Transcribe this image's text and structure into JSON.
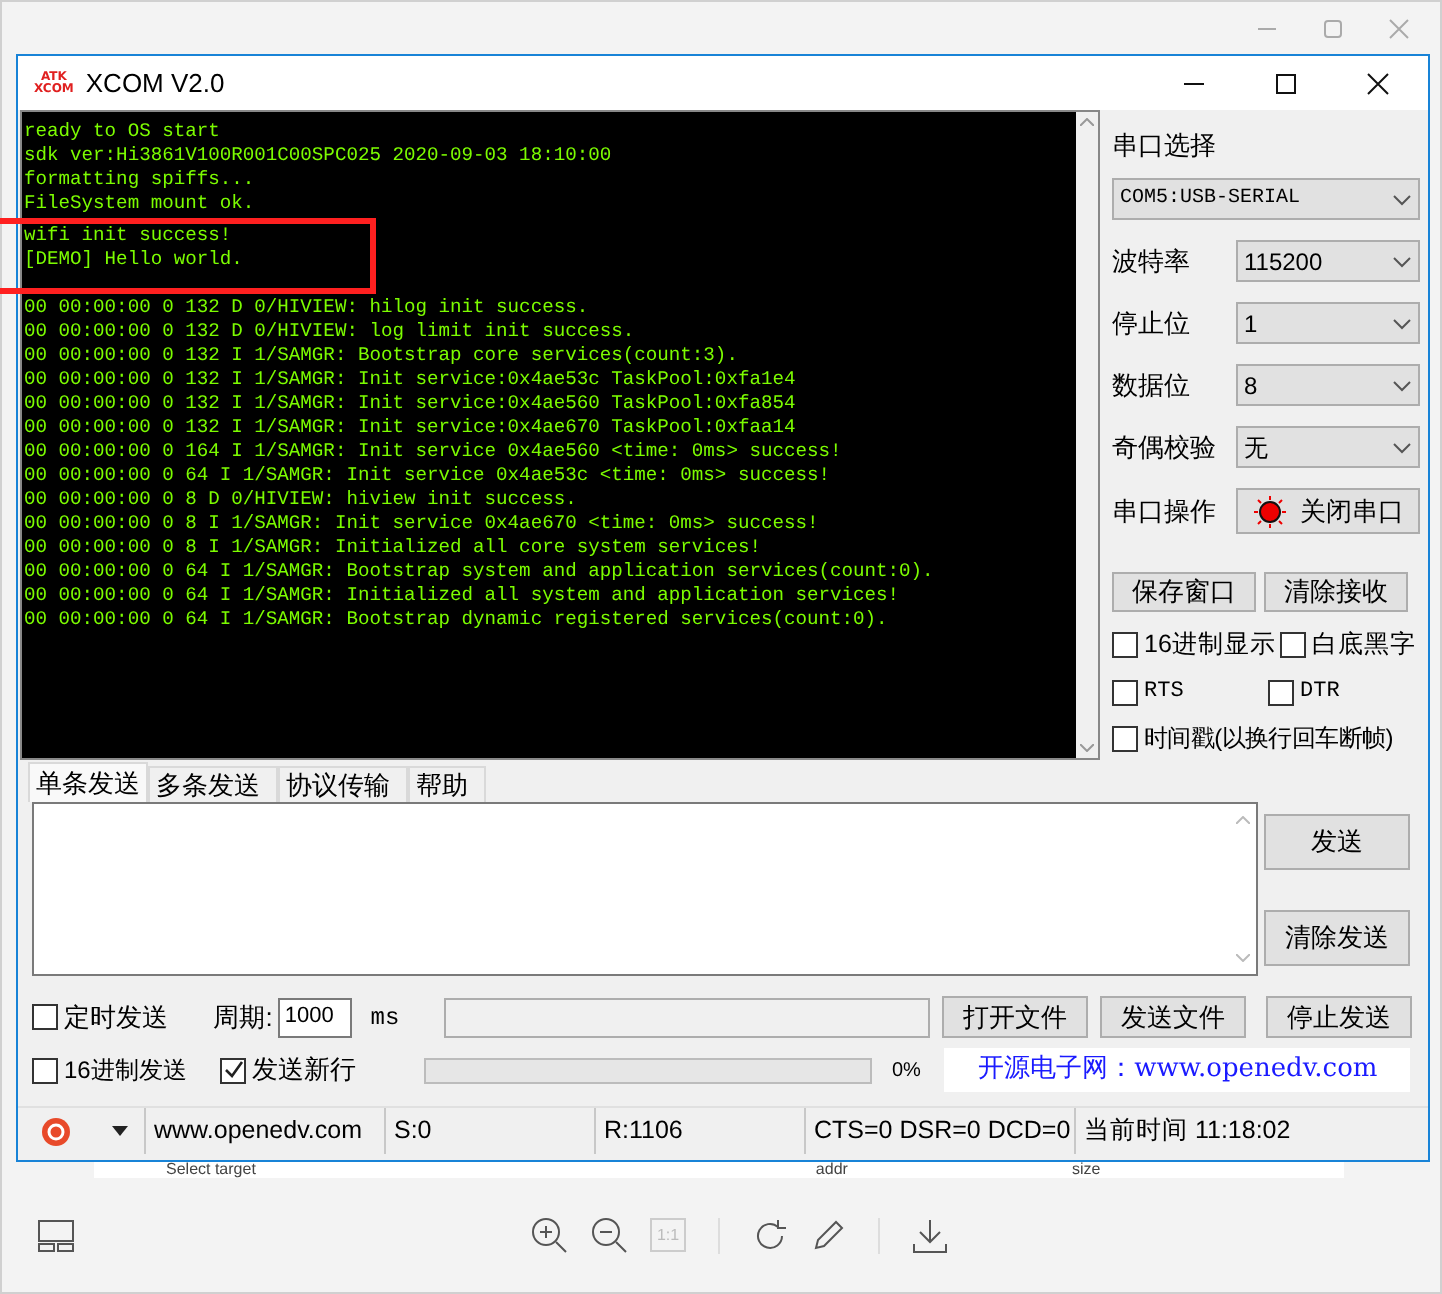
{
  "window": {
    "title": "XCOM V2.0",
    "logo": [
      "ATK",
      "XCOM"
    ]
  },
  "terminal": {
    "boot_lines": [
      "ready to OS start",
      "sdk ver:Hi3861V100R001C00SPC025 2020-09-03 18:10:00",
      "formatting spiffs...",
      "FileSystem mount ok.",
      "wifi init success!",
      "[DEMO] Hello world."
    ],
    "log_lines": [
      "00 00:00:00 0 132 D 0/HIVIEW: hilog init success.",
      "00 00:00:00 0 132 D 0/HIVIEW: log limit init success.",
      "00 00:00:00 0 132 I 1/SAMGR: Bootstrap core services(count:3).",
      "00 00:00:00 0 132 I 1/SAMGR: Init service:0x4ae53c TaskPool:0xfa1e4",
      "00 00:00:00 0 132 I 1/SAMGR: Init service:0x4ae560 TaskPool:0xfa854",
      "00 00:00:00 0 132 I 1/SAMGR: Init service:0x4ae670 TaskPool:0xfaa14",
      "00 00:00:00 0 164 I 1/SAMGR: Init service 0x4ae560 <time: 0ms> success!",
      "00 00:00:00 0 64 I 1/SAMGR: Init service 0x4ae53c <time: 0ms> success!",
      "00 00:00:00 0 8 D 0/HIVIEW: hiview init success.",
      "00 00:00:00 0 8 I 1/SAMGR: Init service 0x4ae670 <time: 0ms> success!",
      "00 00:00:00 0 8 I 1/SAMGR: Initialized all core system services!",
      "00 00:00:00 0 64 I 1/SAMGR: Bootstrap system and application services(count:0).",
      "00 00:00:00 0 64 I 1/SAMGR: Initialized all system and application services!",
      "00 00:00:00 0 64 I 1/SAMGR: Bootstrap dynamic registered services(count:0)."
    ]
  },
  "serial": {
    "heading": "串口选择",
    "port": "COM5:USB-SERIAL",
    "fields": [
      {
        "label": "波特率",
        "value": "115200"
      },
      {
        "label": "停止位",
        "value": "1"
      },
      {
        "label": "数据位",
        "value": "8"
      },
      {
        "label": "奇偶校验",
        "value": "无"
      }
    ],
    "operation": {
      "label": "串口操作",
      "button": "关闭串口",
      "open": true
    },
    "buttons": [
      "保存窗口",
      "清除接收"
    ],
    "checkboxes": [
      {
        "label": "16进制显示",
        "checked": false
      },
      {
        "label": "白底黑字",
        "checked": false
      },
      {
        "label": "RTS",
        "checked": false
      },
      {
        "label": "DTR",
        "checked": false
      },
      {
        "label": "时间戳(以换行回车断帧)",
        "checked": false
      }
    ]
  },
  "send_tabs": [
    {
      "label": "单条发送",
      "selected": true
    },
    {
      "label": "多条发送",
      "selected": false
    },
    {
      "label": "协议传输",
      "selected": false
    },
    {
      "label": "帮助",
      "selected": false
    }
  ],
  "send": {
    "side_buttons": [
      "发送",
      "清除发送"
    ],
    "timed": {
      "label": "定时发送",
      "checked": false
    },
    "period_label": "周期:",
    "period": "1000",
    "unit": "ms",
    "file_buttons": [
      "打开文件",
      "发送文件",
      "停止发送"
    ],
    "hex": {
      "label": "16进制发送",
      "checked": false
    },
    "newline": {
      "label": "发送新行",
      "checked": true
    },
    "progress": {
      "level": 0,
      "reading": "0%"
    },
    "banner": "开源电子网：www.openedv.com"
  },
  "status_bar": [
    "www.openedv.com",
    "S:0",
    "R:1106",
    "CTS=0 DSR=0 DCD=0",
    "当前时间 11:18:02"
  ],
  "background_labels": [
    "Select target",
    "addr",
    "size"
  ],
  "viewer_toolbar": {
    "actual_size": "1:1"
  }
}
